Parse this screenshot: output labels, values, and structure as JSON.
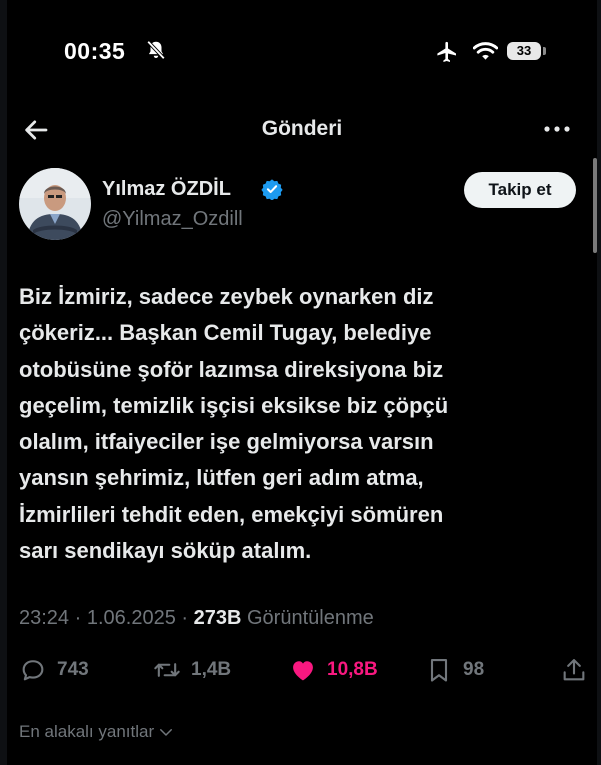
{
  "status_bar": {
    "time": "00:35",
    "battery": "33"
  },
  "nav": {
    "title": "Gönderi"
  },
  "post": {
    "author_name": "Yılmaz ÖZDİL",
    "handle": "@Yilmaz_Ozdill",
    "follow_label": "Takip et",
    "text_lines": [
      "Biz İzmiriz, sadece zeybek oynarken diz",
      "çökeriz... Başkan Cemil Tugay, belediye",
      "otobüsüne şoför lazımsa direksiyona biz",
      "geçelim, temizlik işçisi eksikse biz çöpçü",
      "olalım, itfaiyeciler işe gelmiyorsa varsın",
      "yansın şehrimiz, lütfen geri adım atma,",
      "İzmirlileri tehdit eden, emekçiyi sömüren",
      "sarı sendikayı söküp atalım."
    ],
    "time": "23:24",
    "date": "1.06.2025",
    "views_count": "273B",
    "views_label": "Görüntülenme"
  },
  "actions": {
    "replies": "743",
    "reposts": "1,4B",
    "likes": "10,8B",
    "bookmarks": "98"
  },
  "replies_sort": {
    "label": "En alakalı yanıtlar"
  },
  "colors": {
    "background": "#000000",
    "text": "#e7e9ea",
    "muted": "#71767b",
    "verified": "#1d9bf0",
    "like": "#f91880",
    "follow_button_bg": "#eff3f4"
  }
}
